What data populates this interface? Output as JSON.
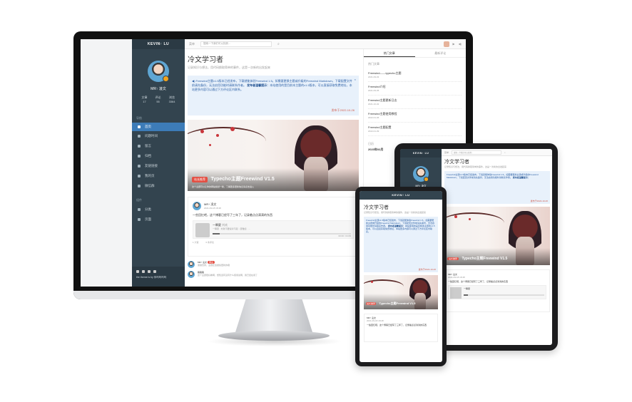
{
  "brand": "KEVIN↑ LU",
  "author": "MR↑ 凌文",
  "site_title": "冷文学习者",
  "site_subtitle": "记录知识与想法，用代码换取简单的事件，这是一次新的出发起来",
  "stats": {
    "labels": [
      "文章",
      "评论",
      "浏览"
    ],
    "values": [
      "17",
      "55",
      "3364"
    ]
  },
  "nav": {
    "section_label": "导航",
    "items": [
      "首页",
      "问题时间",
      "留言",
      "归档",
      "友链链接",
      "我的页",
      "微信群"
    ],
    "section2_label": "组件",
    "items2": [
      "分类",
      "页面"
    ]
  },
  "footer_text": "the theme is by 你吗吗吗吗",
  "topbar": {
    "menu_label": "菜单",
    "search_placeholder": "搜索一下我们可以找到..."
  },
  "notice": {
    "text": "Freewind主题v1.5版本已经发布，下载就能体验Freewind 1.5。如需要更换主题或升级的Freewind Markdown，下载配置文件前请先备份，无法启用功能时请联系作者。",
    "bold_label": "发布者温馨提示：",
    "bold_text": "本站使用的是目前本主题的v1.5版本，可以直接获取免费地址，本站更多内容可以通过下方评论区内联系。",
    "date": "发布于2022-10-26"
  },
  "banner": {
    "tag": "站长推荐",
    "title": "Typecho主题Freewind V1.5",
    "caption": "这个主题可以让你的网站焕然一新，了解更多更新信息请点击进入"
  },
  "post": {
    "author": "MR↑ 凌文",
    "date": "2021-09-18 18:48",
    "text": "一些回忆吧，这个博客已经写了三年了，记录着点点滴滴的东西",
    "likes": "1 大赞",
    "comments": "0 条评论"
  },
  "music": {
    "title": "一瞬夏",
    "artist": "刘欢",
    "subtitle": "一瞬夏 · 刘欢不要说对不起 · 唐雅如 · ...",
    "time": "00:00 / 04:09"
  },
  "comments": [
    {
      "name": "MR↑ 凌文",
      "tag": "博主",
      "text": "谢谢支持，主题还会继续更新的哦"
    },
    {
      "name": "路路路",
      "tag": "",
      "text": "这个主题很好看啊，想知道有没有什么使用说明，我已经在用了"
    }
  ],
  "sidebar_right": {
    "tabs": [
      "热门文章",
      "最新评论"
    ],
    "section_title": "热门文章",
    "articles": [
      {
        "title": "Freewind——typecho主题",
        "meta": "2021-09-03"
      },
      {
        "title": "Freewind介绍",
        "meta": "2021-09-05"
      },
      {
        "title": "Freewind主题更新日志",
        "meta": "2021-10-02"
      },
      {
        "title": "Freewind主题使用教程",
        "meta": "2022-01-06"
      },
      {
        "title": "Freewind主题配置",
        "meta": "2022-01-09"
      }
    ],
    "calendar_label": "日历",
    "calendar_title": "2023年02月"
  }
}
